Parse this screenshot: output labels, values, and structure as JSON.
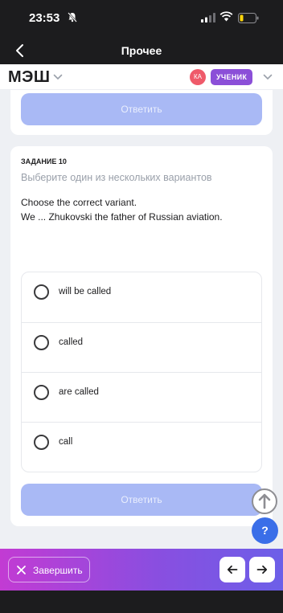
{
  "status_bar": {
    "time": "23:53"
  },
  "nav": {
    "title": "Прочее"
  },
  "header": {
    "logo": "МЭШ",
    "avatar_initials": "КА",
    "role": "УЧЕНИК"
  },
  "previous_task": {
    "answer_label": "Ответить"
  },
  "task": {
    "number": "ЗАДАНИЕ 10",
    "hint": "Выберите один из нескольких вариантов",
    "line1": "Choose  the correct variant.",
    "line2": "We ... Zhukovski the father of Russian aviation.",
    "options": [
      {
        "label": "will be called",
        "selected": false
      },
      {
        "label": "called",
        "selected": false
      },
      {
        "label": "are called",
        "selected": false
      },
      {
        "label": "call",
        "selected": false
      }
    ],
    "answer_label": "Ответить"
  },
  "help": {
    "label": "?"
  },
  "bottom_bar": {
    "finish_label": "Завершить"
  },
  "colors": {
    "accent": "#8b4fd8",
    "button_disabled": "#a9b9f5",
    "help": "#3a6ee8"
  }
}
